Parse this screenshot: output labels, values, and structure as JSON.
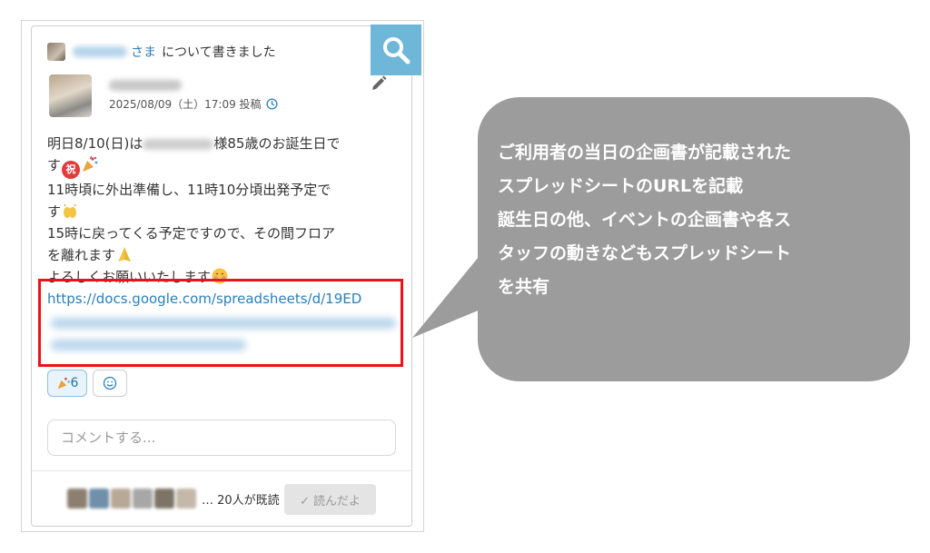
{
  "post": {
    "header_suffix": "さま",
    "header_text": "について書きました",
    "post_meta": "2025/08/09（土）17:09 投稿",
    "body": {
      "l1a": "明日8/10(日)は",
      "l1b": "様85歳のお誕生日で",
      "l2a": "す",
      "l2_badge": "祝",
      "l3": "11時頃に外出準備し、11時10分頃出発予定で",
      "l4": "す",
      "l5": "15時に戻ってくる予定ですので、その間フロア",
      "l6": "を離れます",
      "l7": "よろしくお願いいたします"
    },
    "link": "https://docs.google.com/spreadsheets/d/19ED",
    "reactions": {
      "party_count": "6"
    },
    "comment_placeholder": "コメントする...",
    "readers_text": "… 20人が既読",
    "read_button": "✓ 読んだよ"
  },
  "callout": {
    "lines": [
      "ご利用者の当日の企画書が記載された",
      "スプレッドシートのURLを記載",
      "誕生日の他、イベントの企画書や各ス",
      "タッフの動きなどもスプレッドシート",
      "を共有"
    ]
  },
  "colors": {
    "accent": "#2a7fba",
    "search_bg": "#6fb7d9",
    "highlight": "#e8141a",
    "callout_bg": "#9c9c9c"
  },
  "icons": [
    "search-icon",
    "pencil-icon",
    "clock-icon",
    "smiley-icon",
    "party-popper-icon",
    "clap-icon",
    "pray-icon",
    "blush-icon"
  ]
}
